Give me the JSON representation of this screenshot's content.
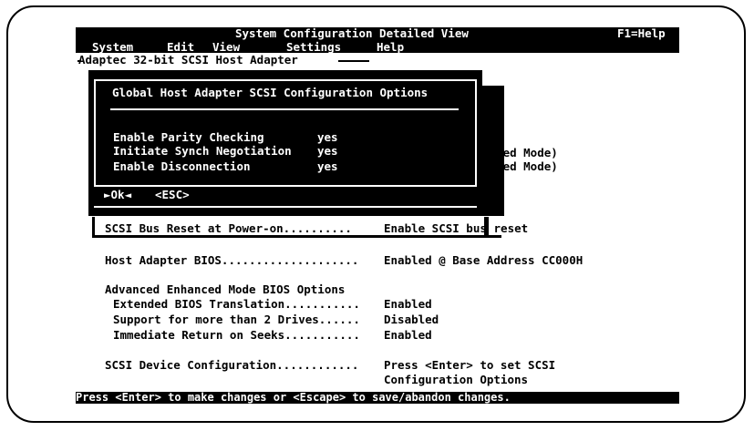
{
  "window": {
    "title": "System Configuration Detailed View",
    "help_hint": "F1=Help"
  },
  "menu": {
    "items": [
      "System",
      "Edit",
      "View",
      "Settings",
      "Help"
    ]
  },
  "frame": {
    "title": "Adaptec 32-bit SCSI Host Adapter"
  },
  "dialog": {
    "title": "Global Host Adapter SCSI Configuration Options",
    "options": [
      {
        "label": "Enable Parity Checking",
        "value": "yes"
      },
      {
        "label": "Initiate Synch Negotiation",
        "value": "yes"
      },
      {
        "label": "Enable Disconnection",
        "value": "yes"
      }
    ],
    "ok_button": "►Ok◄",
    "esc_button": "<ESC>"
  },
  "background_fragments": [
    "anced Mode)",
    "anced Mode)"
  ],
  "settings": {
    "bus_reset": {
      "label": "SCSI Bus Reset at Power-on..........",
      "value": "Enable SCSI bus",
      "value_tail": " reset"
    },
    "bios": {
      "label": "Host Adapter BIOS....................",
      "value": "Enabled @ Base Address CC000H"
    },
    "advanced_header": "Advanced Enhanced Mode BIOS Options",
    "advanced": [
      {
        "label": "Extended BIOS Translation...........",
        "value": "Enabled"
      },
      {
        "label": "Support for more than 2 Drives......",
        "value": "Disabled"
      },
      {
        "label": "Immediate Return on Seeks...........",
        "value": "Enabled"
      }
    ],
    "device_config": {
      "label": "SCSI Device Configuration............",
      "value_line1": "Press <Enter> to set SCSI",
      "value_line2": "Configuration Options"
    }
  },
  "status": {
    "text": "Press <Enter> to make changes or <Escape> to save/abandon changes."
  }
}
